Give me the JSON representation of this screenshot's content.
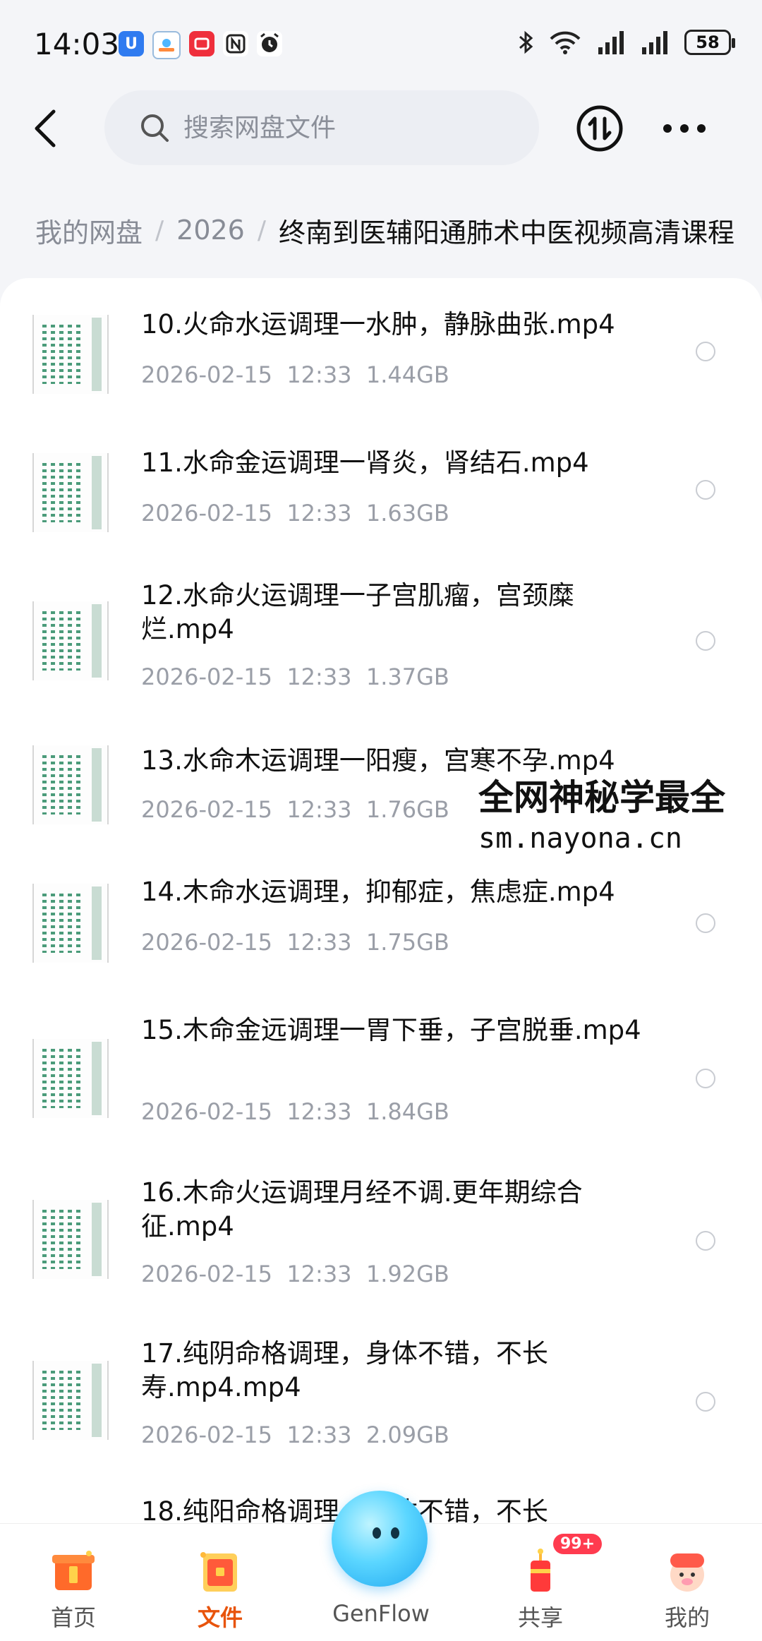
{
  "status_bar": {
    "time": "14:03",
    "battery": "58",
    "icons": [
      "bluetooth-icon",
      "wifi-icon",
      "signal-icon",
      "signal-icon"
    ]
  },
  "header": {
    "search_placeholder": "搜索网盘文件"
  },
  "breadcrumb": {
    "items": [
      "我的网盘",
      "2026"
    ],
    "current": "终南到医辅阳通肺术中医视频高清课程"
  },
  "files": [
    {
      "name": "10.火命水运调理一水肿，静脉曲张.mp4",
      "date": "2026-02-15",
      "time": "12:33",
      "size": "1.44GB"
    },
    {
      "name": "11.水命金运调理一肾炎，肾结石.mp4",
      "date": "2026-02-15",
      "time": "12:33",
      "size": "1.63GB"
    },
    {
      "name": "12.水命火运调理一子宫肌瘤，宫颈糜烂.mp4",
      "date": "2026-02-15",
      "time": "12:33",
      "size": "1.37GB"
    },
    {
      "name": "13.水命木运调理一阳瘦，宫寒不孕.mp4",
      "date": "2026-02-15",
      "time": "12:33",
      "size": "1.76GB"
    },
    {
      "name": "14.木命水运调理，抑郁症，焦虑症.mp4",
      "date": "2026-02-15",
      "time": "12:33",
      "size": "1.75GB"
    },
    {
      "name": "15.木命金远调理一胃下垂，子宫脱垂.mp4",
      "date": "2026-02-15",
      "time": "12:33",
      "size": "1.84GB"
    },
    {
      "name": "16.木命火运调理月经不调.更年期综合征.mp4",
      "date": "2026-02-15",
      "time": "12:33",
      "size": "1.92GB"
    },
    {
      "name": "17.纯阴命格调理，身体不错，不长寿.mp4.mp4",
      "date": "2026-02-15",
      "time": "12:33",
      "size": "2.09GB"
    },
    {
      "name": "18.纯阳命格调理，身体不错，不长",
      "date": "",
      "time": "",
      "size": ""
    }
  ],
  "watermark": {
    "line1": "全网神秘学最全",
    "line2": "sm.nayona.cn"
  },
  "bottom_nav": {
    "home": "首页",
    "files": "文件",
    "genflow": "GenFlow",
    "share": "共享",
    "share_badge": "99+",
    "mine": "我的"
  },
  "colors": {
    "accent": "#e8540c",
    "badge": "#ff3b4f",
    "background": "#f4f5f8"
  }
}
